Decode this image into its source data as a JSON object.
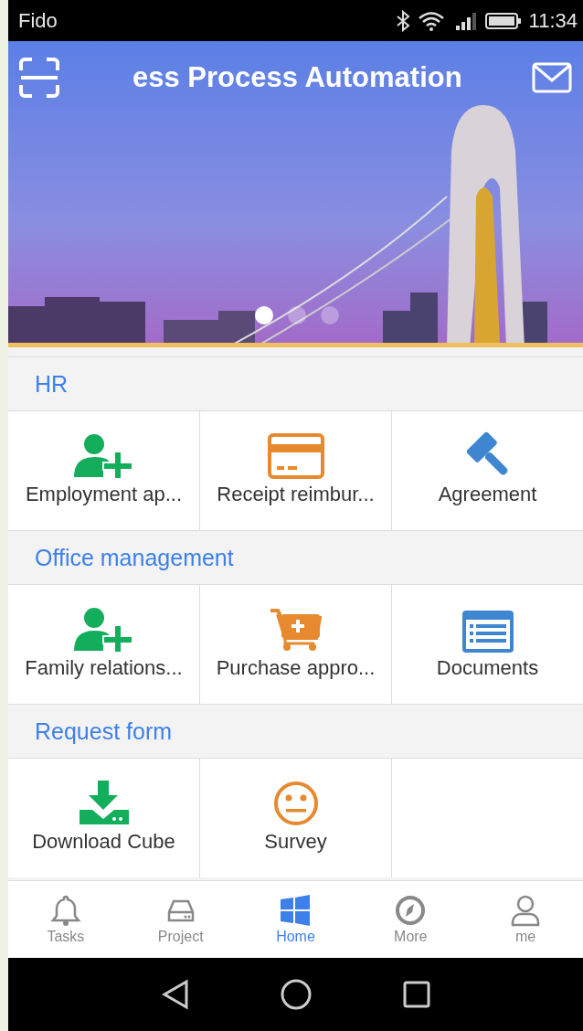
{
  "status_bar": {
    "carrier": "Fido",
    "time": "11:34"
  },
  "header": {
    "title": "ess Process Automation"
  },
  "banner": {
    "kind": "picture",
    "dots": [
      {
        "selected": true
      },
      {
        "selected": false
      },
      {
        "selected": false
      }
    ]
  },
  "sections": [
    {
      "title": "HR",
      "tiles": [
        {
          "label": "Employment ap...",
          "kind": "person-add"
        },
        {
          "label": "Receipt reimbur...",
          "kind": "card"
        },
        {
          "label": "Agreement",
          "kind": "gavel"
        }
      ]
    },
    {
      "title": "Office management",
      "tiles": [
        {
          "label": "Family relations...",
          "kind": "person-add"
        },
        {
          "label": "Purchase appro...",
          "kind": "cart"
        },
        {
          "label": "Documents",
          "kind": "document"
        }
      ]
    },
    {
      "title": "Request form",
      "tiles": [
        {
          "label": "Download Cube",
          "kind": "download"
        },
        {
          "label": "Survey",
          "kind": "face"
        }
      ]
    }
  ],
  "tab_bar": [
    {
      "label": "Tasks",
      "kind": "bell",
      "selected": false
    },
    {
      "label": "Project",
      "kind": "drive",
      "selected": false
    },
    {
      "label": "Home",
      "kind": "windows",
      "selected": true
    },
    {
      "label": "More",
      "kind": "compass",
      "selected": false
    },
    {
      "label": "me",
      "kind": "person",
      "selected": false
    }
  ]
}
